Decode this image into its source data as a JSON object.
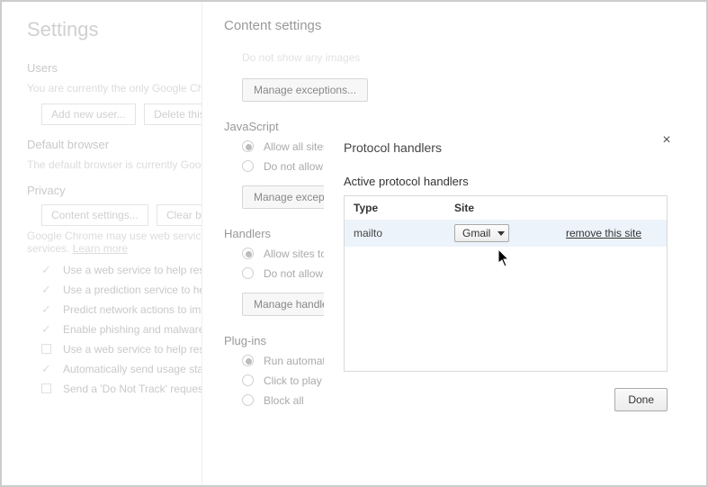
{
  "settings": {
    "title": "Settings",
    "users_heading": "Users",
    "users_desc": "You are currently the only Google Chrome user.",
    "add_user_btn": "Add new user...",
    "delete_user_btn": "Delete this user",
    "default_browser_heading": "Default browser",
    "default_browser_desc": "The default browser is currently Google Chrome.",
    "privacy_heading": "Privacy",
    "content_settings_btn": "Content settings...",
    "clear_browsing_btn": "Clear browsing data...",
    "privacy_desc_1": "Google Chrome may use web services to improve your browsing experience.",
    "privacy_desc_2": "services.",
    "learn_more": "Learn more",
    "chk_resolve": "Use a web service to help resolve navigation errors",
    "chk_prediction": "Use a prediction service to help complete searches",
    "chk_predict_network": "Predict network actions to improve page load performance",
    "chk_phishing": "Enable phishing and malware protection",
    "chk_spell": "Use a web service to help resolve spelling errors",
    "chk_usage": "Automatically send usage statistics",
    "chk_dnt": "Send a 'Do Not Track' request with your browsing traffic"
  },
  "content_settings": {
    "title": "Content settings",
    "ghost_line": "Do not show any images",
    "manage_exceptions": "Manage exceptions...",
    "javascript_heading": "JavaScript",
    "js_allow": "Allow all sites to run JavaScript",
    "js_block": "Do not allow any site to run JavaScript",
    "handlers_heading": "Handlers",
    "handlers_allow": "Allow sites to ask to become default handlers",
    "handlers_block": "Do not allow any site to handle protocols",
    "manage_handlers": "Manage handlers...",
    "plugins_heading": "Plug-ins",
    "plugins_auto": "Run automatically",
    "plugins_click": "Click to play",
    "plugins_block": "Block all"
  },
  "dialog": {
    "title": "Protocol handlers",
    "subtitle": "Active protocol handlers",
    "col_type": "Type",
    "col_site": "Site",
    "row": {
      "type": "mailto",
      "site": "Gmail",
      "remove": "remove this site"
    },
    "done": "Done"
  }
}
